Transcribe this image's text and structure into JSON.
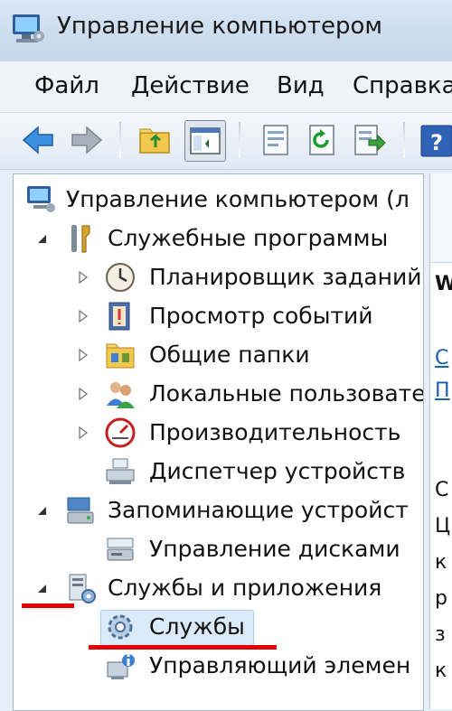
{
  "window": {
    "title": "Управление компьютером"
  },
  "menu": {
    "items": [
      "Файл",
      "Действие",
      "Вид",
      "Справка"
    ]
  },
  "toolbar": {
    "buttons": [
      "back-arrow-icon",
      "forward-arrow-icon",
      "up-folder-icon",
      "show-hide-tree-icon",
      "properties-icon",
      "refresh-icon",
      "export-list-icon",
      "help-icon"
    ]
  },
  "tree": {
    "items": [
      {
        "label": "Управление компьютером (л",
        "icon": "computer-management-icon",
        "expander": "none"
      },
      {
        "label": "Служебные программы",
        "icon": "tools-icon",
        "expander": "expanded"
      },
      {
        "label": "Планировщик заданий",
        "icon": "clock-icon",
        "expander": "collapsed"
      },
      {
        "label": "Просмотр событий",
        "icon": "event-viewer-icon",
        "expander": "collapsed"
      },
      {
        "label": "Общие папки",
        "icon": "shared-folders-icon",
        "expander": "collapsed"
      },
      {
        "label": "Локальные пользовате",
        "icon": "users-icon",
        "expander": "collapsed"
      },
      {
        "label": "Производительность",
        "icon": "performance-icon",
        "expander": "collapsed"
      },
      {
        "label": "Диспетчер устройств",
        "icon": "device-manager-icon",
        "expander": "none"
      },
      {
        "label": "Запоминающие устройст",
        "icon": "storage-icon",
        "expander": "expanded"
      },
      {
        "label": "Управление дисками",
        "icon": "disk-management-icon",
        "expander": "none"
      },
      {
        "label": "Службы и приложения",
        "icon": "services-apps-icon",
        "expander": "expanded"
      },
      {
        "label": "Службы",
        "icon": "services-gear-icon",
        "expander": "none",
        "selected": true
      },
      {
        "label": "Управляющий элемен",
        "icon": "wmi-control-icon",
        "expander": "none"
      }
    ]
  },
  "right_pane": {
    "fragments": [
      "W",
      "C",
      "П",
      "C",
      "Ц",
      "к",
      "р",
      "з",
      "к"
    ]
  },
  "colors": {
    "annotation_red": "#e60000",
    "selection": "#dbeaf9"
  }
}
